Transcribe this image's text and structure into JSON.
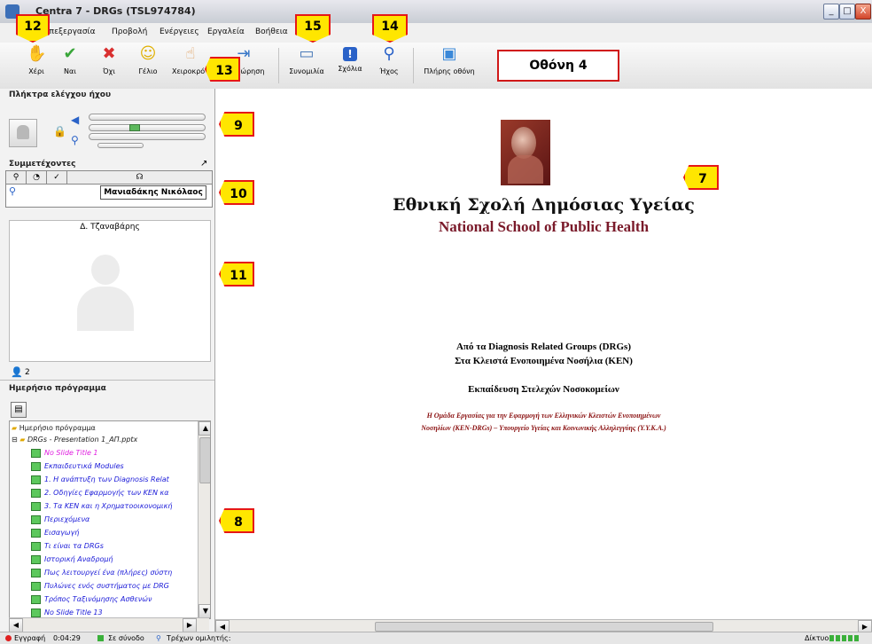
{
  "window": {
    "title": "Centra 7 - DRGs (TSL974784)",
    "minimize": "_",
    "maximize": "□",
    "close": "X"
  },
  "menu": [
    "Επεξεργασία",
    "Προβολή",
    "Ενέργειες",
    "Εργαλεία",
    "Βοήθεια"
  ],
  "toolbar": [
    {
      "label": "Χέρι",
      "icon": "raise-hand-icon",
      "glyph": "✋",
      "color": "#e08a2a"
    },
    {
      "label": "Ναι",
      "icon": "check-icon",
      "glyph": "✔",
      "color": "#3aa63a"
    },
    {
      "label": "Όχι",
      "icon": "x-icon",
      "glyph": "✖",
      "color": "#d93030"
    },
    {
      "label": "Γέλιο",
      "icon": "laugh-icon",
      "glyph": "☺",
      "color": "#e0b000"
    },
    {
      "label": "Χειροκρότ",
      "icon": "applause-icon",
      "glyph": "👏",
      "color": "#e0a060"
    },
    {
      "label": "Αποχώρηση",
      "icon": "leave-icon",
      "glyph": "⇥",
      "color": "#3a78c8"
    },
    {
      "label": "Συνομιλία",
      "icon": "chat-icon",
      "glyph": "▭",
      "color": "#4a7ab8"
    },
    {
      "label": "Σχόλια",
      "icon": "feedback-icon",
      "glyph": "!",
      "color": "#2a62c8"
    },
    {
      "label": "Ήχος",
      "icon": "audio-icon",
      "glyph": "⚲",
      "color": "#2a62c8"
    },
    {
      "label": "Πλήρης οθόνη",
      "icon": "fullscreen-icon",
      "glyph": "▣",
      "color": "#3a88d8"
    }
  ],
  "screen_label": "Οθόνη 4",
  "left": {
    "audio_header": "Πλήκτρα ελέγχου ήχου",
    "participants_header": "Συμμετέχοντες",
    "participant_name": "Μανιαδάκης Νικόλαος",
    "video_name": "Δ. Τζαναβάρης",
    "participant_count": "2",
    "schedule_header": "Ημερήσιο πρόγραμμα",
    "tree_root": "Ημερήσιο πρόγραμμα",
    "tree_file": "DRGs - Presentation 1_ΑΠ.pptx",
    "tree_items": [
      {
        "label": "No Slide Title 1",
        "color": "#e020e0"
      },
      {
        "label": "Εκπαιδευτικά Modules",
        "color": "#1a1ad8"
      },
      {
        "label": "1.  Η ανάπτυξη των Diagnosis Relat",
        "color": "#1a1ad8"
      },
      {
        "label": "2.  Οδηγίες Εφαρμογής των ΚΕΝ κα",
        "color": "#1a1ad8"
      },
      {
        "label": "3. Τα ΚΕΝ και η Χρηματοοικονομική",
        "color": "#1a1ad8"
      },
      {
        "label": "Περιεχόμενα",
        "color": "#1a1ad8"
      },
      {
        "label": "Εισαγωγή",
        "color": "#1a1ad8"
      },
      {
        "label": "Τι είναι τα DRGs",
        "color": "#1a1ad8"
      },
      {
        "label": "Ιστορική Αναδρομή",
        "color": "#1a1ad8"
      },
      {
        "label": "Πως λειτουργεί ένα (πλήρες) σύστη",
        "color": "#1a1ad8"
      },
      {
        "label": "Πυλώνες ενός συστήματος με DRG",
        "color": "#1a1ad8"
      },
      {
        "label": "Τρόπος Ταξινόμησης Ασθενών",
        "color": "#1a1ad8"
      },
      {
        "label": "No Slide Title 13",
        "color": "#1a1ad8"
      }
    ]
  },
  "slide": {
    "title_gr": "Εθνική Σχολή Δημόσιας Υγείας",
    "title_en": "National School of Public Health",
    "line1": "Από τα Diagnosis Related Groups (DRGs)",
    "line2": "Στα Κλειστά Ενοποιημένα Νοσήλια (ΚΕΝ)",
    "line3": "Εκπαίδευση Στελεχών Νοσοκομείων",
    "line4": "Η Ομάδα Εργασίας για την Εφαρμογή των Ελληνικών Κλειστών Ενοποιημένων",
    "line5": "Νοσηλίων (ΚΕΝ-DRGs) – Υπουργείο Υγείας και Κοινωνικής Αλληλεγγύης (Υ.Υ.Κ.Α.)"
  },
  "status": {
    "record": "Εγγραφή",
    "time": "0:04:29",
    "session": "Σε σύνοδο",
    "speaker": "Τρέχων ομιλητής:",
    "network": "Δίκτυο:"
  },
  "callouts": {
    "c12": "12",
    "c13": "13",
    "c15": "15",
    "c14": "14",
    "c9": "9",
    "c10": "10",
    "c11": "11",
    "c7": "7",
    "c8": "8"
  }
}
